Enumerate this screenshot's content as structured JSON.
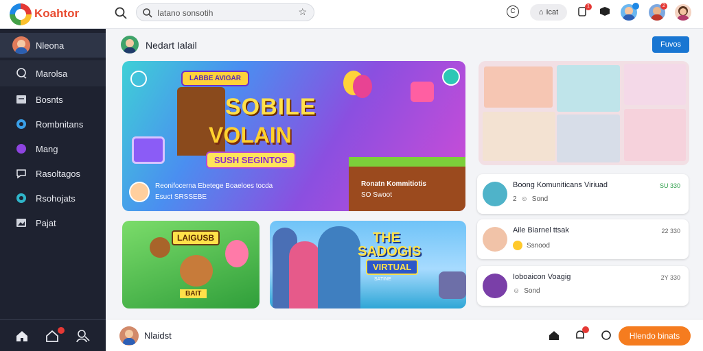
{
  "app": {
    "brand": "Koahtor",
    "search_placeholder": "Iatano sonsotih",
    "top_button_label": "Icat",
    "copy_symbol": "C",
    "accent_color": "#f57c1f",
    "primary_color": "#1976d2",
    "header_badges": {
      "notif": "1",
      "profile": "2"
    }
  },
  "sidebar": {
    "items": [
      {
        "label": "Nleona",
        "icon": "avatar-icon"
      },
      {
        "label": "Marolsa",
        "icon": "chat-icon"
      },
      {
        "label": "Bosnts",
        "icon": "book-icon"
      },
      {
        "label": "Rombnitans",
        "icon": "bubble-icon"
      },
      {
        "label": "Mang",
        "icon": "dot-icon"
      },
      {
        "label": "Rasoltagos",
        "icon": "comment-icon"
      },
      {
        "label": "Rsohojats",
        "icon": "bubble-icon"
      },
      {
        "label": "Pajat",
        "icon": "image-icon"
      }
    ]
  },
  "feed": {
    "title": "Nedart Ialail",
    "action_button": "Fuvos"
  },
  "hero": {
    "tag": "LABBE AVIGAR",
    "title1": "SOBILE",
    "title2": "VOLAIN",
    "subtitle": "SUSH SEGINTOS",
    "caption_line1": "Reonifocerna Ebetege Boaeloes tocda",
    "caption_line2": "Esuct    SRSSEBE",
    "side_caption1": "Ronatn Kommitiotis",
    "side_caption2": "SO Swoot"
  },
  "green_card": {
    "tag": "LAIGUSB",
    "sign": "BAIT"
  },
  "blue_card": {
    "title1": "THE",
    "title2": "SADOGIS",
    "title3": "VIRTUAL",
    "tag": "SATINE"
  },
  "list": [
    {
      "title": "Boong Komuniticans Viriuad",
      "meta": "Sond",
      "count": "2",
      "number": "SU 330"
    },
    {
      "title": "Aile Biarnel ttsak",
      "meta": "Ssnood",
      "count": "",
      "number": "22 330"
    },
    {
      "title": "Ioboaicon Voagig",
      "meta": "Sond",
      "count": "",
      "number": "2Y 330"
    }
  ],
  "bottom": {
    "name": "Nlaidst",
    "cta": "Hlendo binats"
  }
}
